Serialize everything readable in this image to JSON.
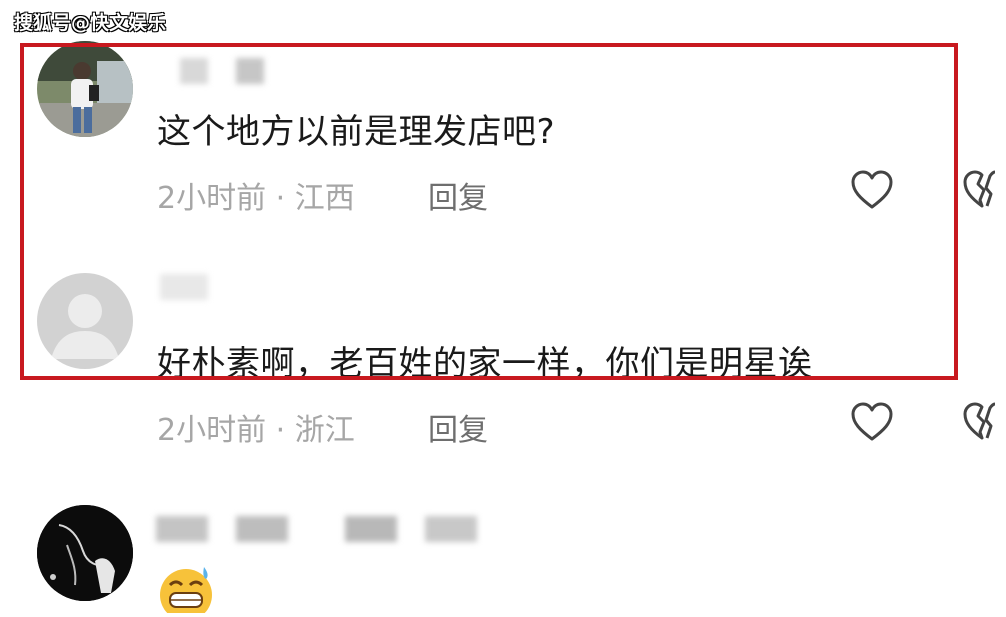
{
  "watermark": "搜狐号@快文娱乐",
  "comments": [
    {
      "text": "这个地方以前是理发店吧?",
      "time": "2小时前",
      "sep": " · ",
      "location": "江西",
      "reply_label": "回复"
    },
    {
      "text": "好朴素啊，老百姓的家一样，你们是明星诶",
      "time": "2小时前",
      "sep": " · ",
      "location": "浙江",
      "reply_label": "回复"
    },
    {
      "emoji": "grinning-sweat-emoji"
    }
  ],
  "icons": {
    "like": "heart-outline-icon",
    "dislike": "broken-heart-icon"
  },
  "colors": {
    "highlight": "#c8191f",
    "meta_text": "#a6a6a6",
    "reply_text": "#6e6e6e"
  }
}
